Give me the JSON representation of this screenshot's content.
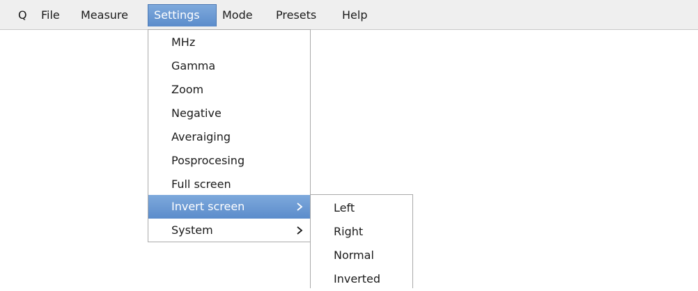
{
  "menubar": {
    "items": [
      {
        "label": "Q"
      },
      {
        "label": "File"
      },
      {
        "label": "Measure"
      },
      {
        "label": "Settings"
      },
      {
        "label": "Mode"
      },
      {
        "label": "Presets"
      },
      {
        "label": "Help"
      }
    ]
  },
  "settings_menu": {
    "items": [
      {
        "label": "MHz"
      },
      {
        "label": "Gamma"
      },
      {
        "label": "Zoom"
      },
      {
        "label": "Negative"
      },
      {
        "label": "Averaiging"
      },
      {
        "label": "Posprocesing"
      },
      {
        "label": "Full screen"
      },
      {
        "label": "Invert screen",
        "submenu_icon": "chevron-right-icon"
      },
      {
        "label": "System",
        "submenu_icon": "chevron-right-icon"
      }
    ]
  },
  "invert_submenu": {
    "items": [
      {
        "label": "Left"
      },
      {
        "label": "Right"
      },
      {
        "label": "Normal"
      },
      {
        "label": "Inverted"
      }
    ]
  },
  "colors": {
    "highlight": "#6f9bd4",
    "menubar_bg": "#efefef",
    "text": "#1a1a1a"
  }
}
